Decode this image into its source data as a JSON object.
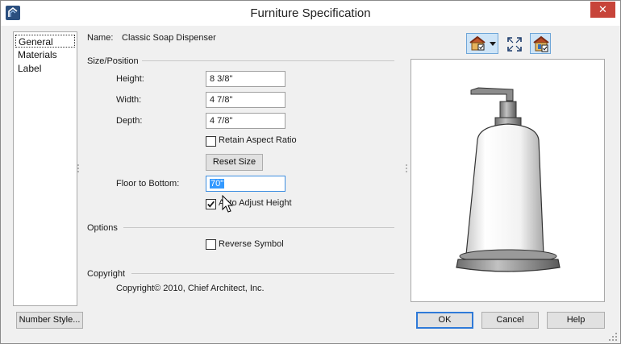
{
  "window": {
    "title": "Furniture Specification",
    "close_symbol": "✕"
  },
  "tabs": [
    {
      "label": "General",
      "selected": true
    },
    {
      "label": "Materials",
      "selected": false
    },
    {
      "label": "Label",
      "selected": false
    }
  ],
  "name": {
    "label": "Name:",
    "value": "Classic Soap Dispenser"
  },
  "size_position": {
    "title": "Size/Position",
    "height": {
      "label": "Height:",
      "value": "8 3/8\""
    },
    "width": {
      "label": "Width:",
      "value": "4 7/8\""
    },
    "depth": {
      "label": "Depth:",
      "value": "4 7/8\""
    },
    "retain_aspect_ratio": {
      "label": "Retain Aspect Ratio",
      "checked": false
    },
    "reset_size_label": "Reset Size",
    "floor_to_bottom": {
      "label": "Floor to Bottom:",
      "value": "70\""
    },
    "auto_adjust_height": {
      "label": "Auto Adjust Height",
      "checked": true
    }
  },
  "options": {
    "title": "Options",
    "reverse_symbol": {
      "label": "Reverse Symbol",
      "checked": false
    }
  },
  "copyright": {
    "title": "Copyright",
    "text": "Copyright© 2010, Chief Architect, Inc."
  },
  "preview_toolbar": [
    {
      "icon": "render-view-icon",
      "has_dropdown": true,
      "active": true
    },
    {
      "icon": "fill-window-icon",
      "has_dropdown": false,
      "active": false
    },
    {
      "icon": "display-options-icon",
      "has_dropdown": false,
      "active": true
    }
  ],
  "buttons": {
    "number_style": "Number Style...",
    "ok": "OK",
    "cancel": "Cancel",
    "help": "Help"
  },
  "colors": {
    "accent": "#3399ff",
    "default_button_border": "#2f7ad8",
    "close_button": "#c7443a",
    "dialog_background": "#f0f0f0"
  }
}
